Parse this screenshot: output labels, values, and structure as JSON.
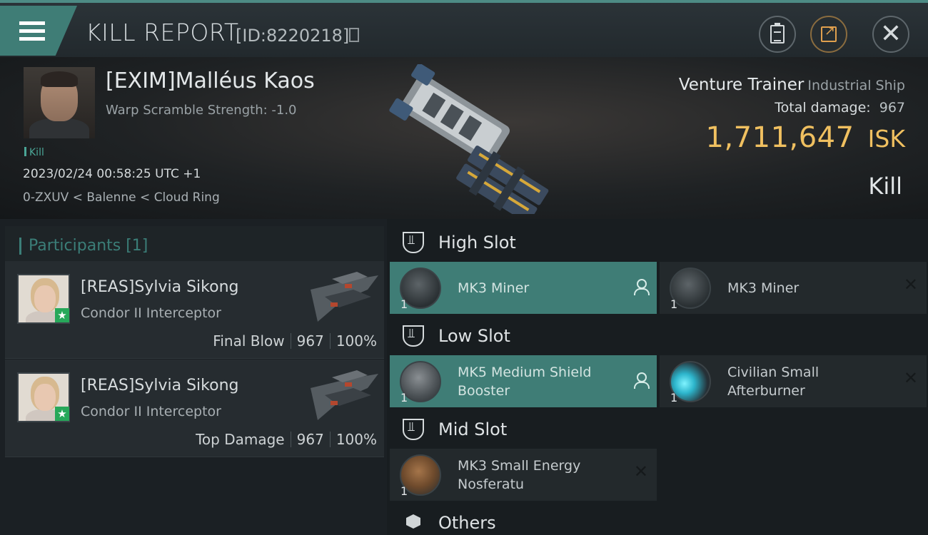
{
  "header": {
    "title": "KILL REPORT",
    "report_id": "[ID:8220218]"
  },
  "victim": {
    "name": "[EXIM]Malléus Kaos",
    "warp_scramble": "Warp Scramble Strength: -1.0",
    "tag": "Kill",
    "time": "2023/02/24 00:58:25 UTC +1",
    "location": "0-ZXUV < Balenne < Cloud Ring",
    "ship_name": "Venture Trainer",
    "ship_class": "Industrial Ship",
    "total_damage_label": "Total damage:",
    "total_damage": "967",
    "isk_value": "1,711,647",
    "isk_unit": "ISK",
    "result": "Kill"
  },
  "participants": {
    "header": "Participants [1]",
    "items": [
      {
        "name": "[REAS]Sylvia Sikong",
        "ship": "Condor II Interceptor",
        "role": "Final Blow",
        "damage": "967",
        "percent": "100%"
      },
      {
        "name": "[REAS]Sylvia Sikong",
        "ship": "Condor II Interceptor",
        "role": "Top Damage",
        "damage": "967",
        "percent": "100%"
      }
    ]
  },
  "slots": {
    "high": {
      "label": "High Slot",
      "modules": [
        {
          "name": "MK3 Miner",
          "qty": "1",
          "icon": "miner-icon"
        },
        {
          "name": "MK3 Miner",
          "qty": "1",
          "icon": "miner-icon"
        }
      ]
    },
    "low": {
      "label": "Low Slot",
      "modules": [
        {
          "name": "MK5 Medium Shield Booster",
          "qty": "1",
          "icon": "shield-booster-icon"
        },
        {
          "name": "Civilian Small Afterburner",
          "qty": "1",
          "icon": "afterburner-icon"
        }
      ]
    },
    "mid": {
      "label": "Mid Slot",
      "modules": [
        {
          "name": "MK3 Small Energy Nosferatu",
          "qty": "1",
          "icon": "nosferatu-icon"
        }
      ]
    },
    "others": {
      "label": "Others"
    }
  },
  "colors": {
    "accent_teal": "#3f7d76",
    "isk_gold": "#f0c060",
    "status_green": "#27a85a"
  }
}
